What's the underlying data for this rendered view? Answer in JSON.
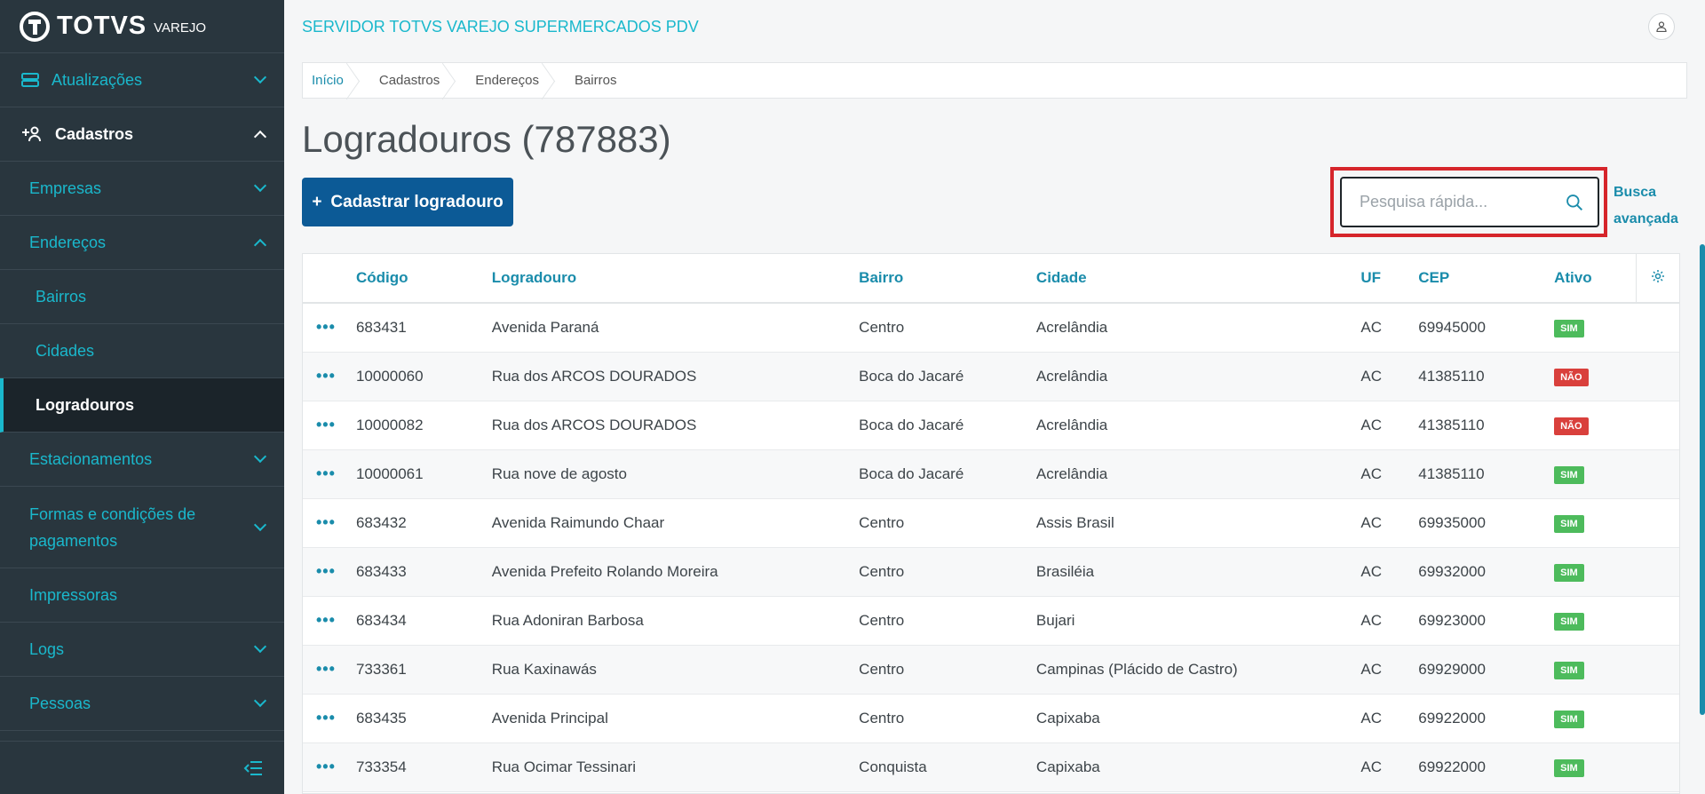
{
  "brand": {
    "name": "TOTVS",
    "sub": "VAREJO"
  },
  "header": {
    "title": "SERVIDOR TOTVS VAREJO SUPERMERCADOS PDV"
  },
  "sidebar": {
    "items": [
      {
        "label": "Atualizações"
      },
      {
        "label": "Cadastros"
      },
      {
        "label": "Empresas"
      },
      {
        "label": "Endereços"
      },
      {
        "label": "Bairros"
      },
      {
        "label": "Cidades"
      },
      {
        "label": "Logradouros"
      },
      {
        "label": "Estacionamentos"
      },
      {
        "label": "Formas e condições de pagamentos"
      },
      {
        "label": "Impressoras"
      },
      {
        "label": "Logs"
      },
      {
        "label": "Pessoas"
      }
    ]
  },
  "breadcrumb": [
    "Início",
    "Cadastros",
    "Endereços",
    "Bairros"
  ],
  "page": {
    "title": "Logradouros (787883)",
    "add_button": "Cadastrar logradouro",
    "search_placeholder": "Pesquisa rápida...",
    "advanced_search": "Busca avançada"
  },
  "table": {
    "headers": [
      "Código",
      "Logradouro",
      "Bairro",
      "Cidade",
      "UF",
      "CEP",
      "Ativo"
    ],
    "rows": [
      {
        "codigo": "683431",
        "logradouro": "Avenida Paraná",
        "bairro": "Centro",
        "cidade": "Acrelândia",
        "uf": "AC",
        "cep": "69945000",
        "ativo": "SIM"
      },
      {
        "codigo": "10000060",
        "logradouro": "Rua dos ARCOS DOURADOS",
        "bairro": "Boca do Jacaré",
        "cidade": "Acrelândia",
        "uf": "AC",
        "cep": "41385110",
        "ativo": "NÃO"
      },
      {
        "codigo": "10000082",
        "logradouro": "Rua dos ARCOS DOURADOS",
        "bairro": "Boca do Jacaré",
        "cidade": "Acrelândia",
        "uf": "AC",
        "cep": "41385110",
        "ativo": "NÃO"
      },
      {
        "codigo": "10000061",
        "logradouro": "Rua nove de agosto",
        "bairro": "Boca do Jacaré",
        "cidade": "Acrelândia",
        "uf": "AC",
        "cep": "41385110",
        "ativo": "SIM"
      },
      {
        "codigo": "683432",
        "logradouro": "Avenida Raimundo Chaar",
        "bairro": "Centro",
        "cidade": "Assis Brasil",
        "uf": "AC",
        "cep": "69935000",
        "ativo": "SIM"
      },
      {
        "codigo": "683433",
        "logradouro": "Avenida Prefeito Rolando Moreira",
        "bairro": "Centro",
        "cidade": "Brasiléia",
        "uf": "AC",
        "cep": "69932000",
        "ativo": "SIM"
      },
      {
        "codigo": "683434",
        "logradouro": "Rua Adoniran Barbosa",
        "bairro": "Centro",
        "cidade": "Bujari",
        "uf": "AC",
        "cep": "69923000",
        "ativo": "SIM"
      },
      {
        "codigo": "733361",
        "logradouro": "Rua Kaxinawás",
        "bairro": "Centro",
        "cidade": "Campinas (Plácido de Castro)",
        "uf": "AC",
        "cep": "69929000",
        "ativo": "SIM"
      },
      {
        "codigo": "683435",
        "logradouro": "Avenida Principal",
        "bairro": "Centro",
        "cidade": "Capixaba",
        "uf": "AC",
        "cep": "69922000",
        "ativo": "SIM"
      },
      {
        "codigo": "733354",
        "logradouro": "Rua Ocimar Tessinari",
        "bairro": "Conquista",
        "cidade": "Capixaba",
        "uf": "AC",
        "cep": "69922000",
        "ativo": "SIM"
      }
    ]
  },
  "colors": {
    "accent": "#1ab8cc",
    "primary": "#0c5a96",
    "sidebar_bg": "#29363e",
    "highlight": "#d6252b",
    "active_yes": "#4dbb5c",
    "active_no": "#d9403c"
  }
}
